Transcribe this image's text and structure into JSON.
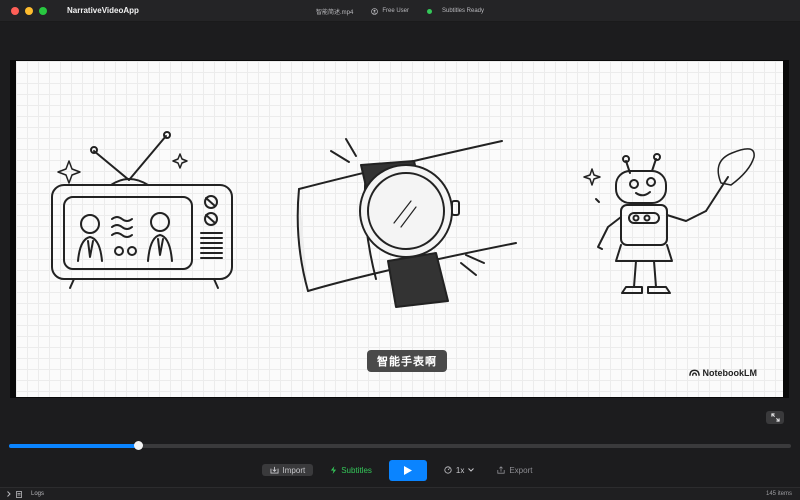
{
  "window": {
    "app_name": "NarrativeVideoApp",
    "file_name": "智能简述.mp4",
    "user": "Free User",
    "status": "Subtitles Ready",
    "colors": {
      "close": "#ff5f57",
      "minimize": "#febc2e",
      "zoom": "#28c840"
    }
  },
  "video": {
    "subtitle": "智能手表啊",
    "watermark": "NotebookLM"
  },
  "timeline": {
    "progress": 0.166
  },
  "controls": {
    "import_label": "Import",
    "subtitles_label": "Subtitles",
    "speed_label": "1x",
    "export_label": "Export"
  },
  "statusbar": {
    "logs_label": "Logs",
    "item_count": "145 items"
  },
  "icons": [
    "import-icon",
    "subtitles-icon",
    "play-icon",
    "speed-icon",
    "export-icon",
    "user-icon",
    "expand-icon",
    "logs-icon",
    "chevron-right-icon"
  ],
  "theme": {
    "accent": "#0a84ff",
    "success": "#34c759"
  }
}
